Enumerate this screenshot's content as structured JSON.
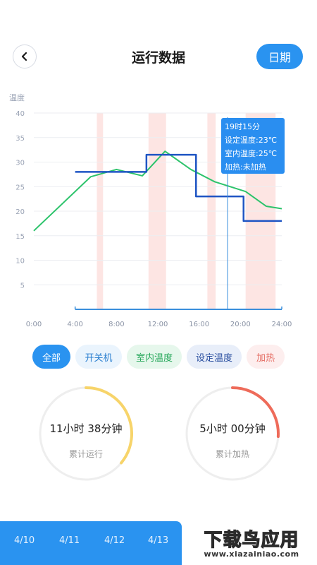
{
  "header": {
    "back_icon": "chevron-left-icon",
    "title": "运行数据",
    "date_button": "日期"
  },
  "chart_data": {
    "type": "line",
    "ylabel": "温度",
    "ylim": [
      0,
      40
    ],
    "yticks": [
      5,
      10,
      15,
      20,
      25,
      30,
      35,
      40
    ],
    "xlim": [
      0,
      24
    ],
    "xticks": [
      "0:00",
      "4:00",
      "8:00",
      "12:00",
      "16:00",
      "20:00",
      "24:00"
    ],
    "grid": true,
    "heating_periods_hours": [
      [
        6.1,
        6.7
      ],
      [
        11.1,
        12.8
      ],
      [
        16.8,
        17.6
      ],
      [
        20.5,
        23.4
      ]
    ],
    "power_on_hours": [
      4.0,
      24.0
    ],
    "series": [
      {
        "name": "室内温度",
        "color": "#2cc36b",
        "x": [
          0,
          5.5,
          8,
          10.5,
          12.7,
          15.2,
          17.5,
          20.5,
          22.5,
          24
        ],
        "y": [
          16,
          27,
          28.5,
          27.2,
          32.2,
          28.5,
          26,
          24,
          21,
          20.5
        ]
      },
      {
        "name": "设定温度",
        "color": "#1f55c4",
        "x": [
          4,
          10.9,
          10.9,
          15.7,
          15.7,
          20.3,
          20.3,
          24
        ],
        "y": [
          28,
          28,
          31.5,
          31.5,
          23,
          23,
          18,
          18
        ]
      }
    ],
    "tooltip": {
      "x_hour": 18.75,
      "lines": [
        "19时15分",
        "设定温度:23℃",
        "室内温度:25℃",
        "加热:未加热"
      ]
    }
  },
  "filters": [
    {
      "label": "全部",
      "active": true
    },
    {
      "label": "开关机",
      "active": false
    },
    {
      "label": "室内温度",
      "active": false
    },
    {
      "label": "设定温度",
      "active": false
    },
    {
      "label": "加热",
      "active": false
    }
  ],
  "stats": [
    {
      "value": "11小时 38分钟",
      "label": "累计运行",
      "color": "#f7d46a",
      "fraction": 0.36
    },
    {
      "value": "5小时 00分钟",
      "label": "累计加热",
      "color": "#ee6b5a",
      "fraction": 0.26
    }
  ],
  "date_tabs": [
    "4/10",
    "4/11",
    "4/12",
    "4/13"
  ],
  "watermark": {
    "title": "下载鸟应用",
    "url": "www.xiazainiao.com"
  }
}
